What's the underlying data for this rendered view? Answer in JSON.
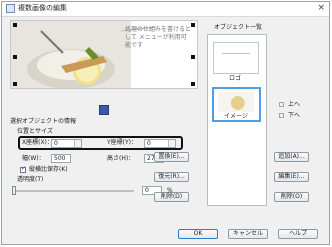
{
  "window": {
    "title": "複数画像の編集",
    "close": "×"
  },
  "preview": {
    "note": "処理の仕組みを書けるとして\nメニューが利用可能です"
  },
  "object_info": {
    "group_title": "選択オブジェクトの情報",
    "position_label": "位置とサイズ",
    "x_label": "X座標(X)：",
    "x_value": "0",
    "y_label": "Y座標(Y)：",
    "y_value": "0",
    "width_label": "幅(W)：",
    "width_value": "500",
    "height_label": "高さ(H)：",
    "height_value": "270",
    "keep_ratio_label": "縦横比保存(K)",
    "transparency_label": "透明度(T)",
    "transparency_value": "0",
    "transparency_unit": "%"
  },
  "buttons": {
    "replace": "置換(E)...",
    "restore": "復元(R)...",
    "delete": "削除(D)",
    "add": "追加(A)...",
    "edit": "編集(E)...",
    "remove": "削除(O)",
    "ok": "OK",
    "cancel": "キャンセル",
    "help": "ヘルプ"
  },
  "object_list": {
    "title": "オブジェクト一覧",
    "items": [
      {
        "label": "ロゴ"
      },
      {
        "label": "イメージ"
      }
    ],
    "move_up": "上へ",
    "move_down": "下へ"
  }
}
